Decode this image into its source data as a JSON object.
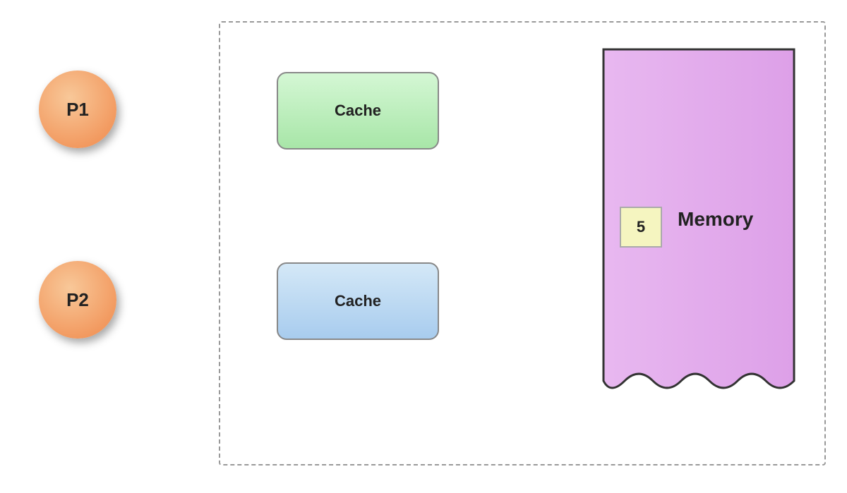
{
  "processors": [
    {
      "id": "p1",
      "label": "P1"
    },
    {
      "id": "p2",
      "label": "P2"
    }
  ],
  "caches": [
    {
      "id": "cache1",
      "label": "Cache",
      "color": "green"
    },
    {
      "id": "cache2",
      "label": "Cache",
      "color": "blue"
    }
  ],
  "memory": {
    "label": "Memory",
    "cell_value": "5"
  }
}
